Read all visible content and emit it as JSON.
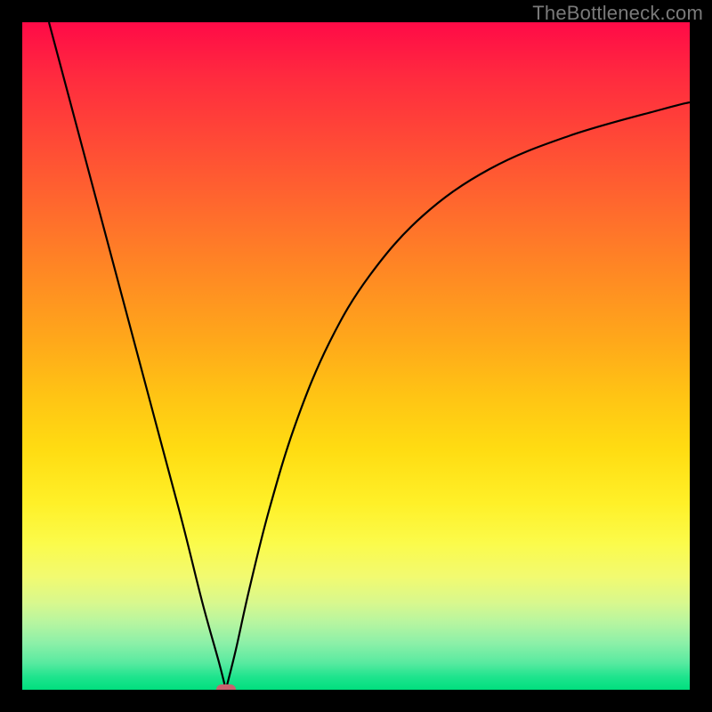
{
  "watermark": "TheBottleneck.com",
  "chart_data": {
    "type": "line",
    "title": "",
    "xlabel": "",
    "ylabel": "",
    "xlim": [
      0,
      100
    ],
    "ylim": [
      0,
      100
    ],
    "grid": false,
    "legend": false,
    "background_gradient": {
      "direction": "vertical",
      "stops": [
        {
          "pos": 0.0,
          "color": "#ff0a47"
        },
        {
          "pos": 0.18,
          "color": "#ff4a36"
        },
        {
          "pos": 0.38,
          "color": "#ff8a23"
        },
        {
          "pos": 0.56,
          "color": "#ffc414"
        },
        {
          "pos": 0.72,
          "color": "#fff028"
        },
        {
          "pos": 0.83,
          "color": "#f2fa70"
        },
        {
          "pos": 0.9,
          "color": "#b6f5a0"
        },
        {
          "pos": 0.96,
          "color": "#58eaa0"
        },
        {
          "pos": 1.0,
          "color": "#00df7e"
        }
      ]
    },
    "series": [
      {
        "name": "left-branch",
        "x": [
          4,
          8,
          12,
          16,
          20,
          24,
          27,
          29.5,
          30.5
        ],
        "y": [
          100,
          85,
          70,
          55,
          40,
          25,
          13,
          4,
          0
        ]
      },
      {
        "name": "right-branch",
        "x": [
          30.5,
          32,
          34,
          37,
          41,
          46,
          52,
          60,
          70,
          82,
          96,
          100
        ],
        "y": [
          0,
          6,
          15,
          27,
          40,
          52,
          62,
          71,
          78,
          83,
          87,
          88
        ]
      }
    ],
    "marker": {
      "x": 30.5,
      "y": 0,
      "shape": "rounded-rect",
      "color": "#c9616e"
    }
  },
  "colors": {
    "curve_stroke": "#000000",
    "frame": "#000000",
    "watermark": "#7a7a7a"
  }
}
